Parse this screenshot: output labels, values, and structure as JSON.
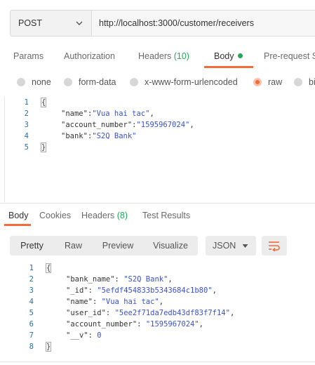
{
  "request": {
    "method": "POST",
    "url": "http://localhost:3000/customer/receivers"
  },
  "request_tabs": [
    {
      "label": "Params"
    },
    {
      "label": "Authorization"
    },
    {
      "label": "Headers",
      "count": "(10)"
    },
    {
      "label": "Body"
    },
    {
      "label": "Pre-request S"
    }
  ],
  "body_types": [
    {
      "label": "none",
      "selected": false
    },
    {
      "label": "form-data",
      "selected": false
    },
    {
      "label": "x-www-form-urlencoded",
      "selected": false
    },
    {
      "label": "raw",
      "selected": true
    },
    {
      "label": "bi",
      "selected": false
    }
  ],
  "request_body": {
    "line_numbers": [
      "1",
      "2",
      "3",
      "4",
      "5"
    ],
    "open": "{",
    "close": "}",
    "fields": [
      {
        "key": "\"name\"",
        "sep": ":",
        "value": "\"Vua hai tac\"",
        "trail": ","
      },
      {
        "key": "\"account_number\"",
        "sep": ":",
        "value": "\"1595967024\"",
        "trail": ","
      },
      {
        "key": "\"bank\"",
        "sep": ":",
        "value": "\"S2Q Bank\"",
        "trail": ""
      }
    ]
  },
  "response_tabs": [
    {
      "label": "Body"
    },
    {
      "label": "Cookies"
    },
    {
      "label": "Headers",
      "count": "(8)"
    },
    {
      "label": "Test Results"
    }
  ],
  "view_modes": [
    "Pretty",
    "Raw",
    "Preview",
    "Visualize"
  ],
  "format": "JSON",
  "response_body": {
    "line_numbers": [
      "1",
      "2",
      "3",
      "4",
      "5",
      "6",
      "7",
      "8"
    ],
    "open": "{",
    "close": "}",
    "fields": [
      {
        "key": "\"bank_name\"",
        "sep": ": ",
        "value": "\"S2Q Bank\"",
        "trail": ","
      },
      {
        "key": "\"_id\"",
        "sep": ": ",
        "value": "\"5efdf454833b5343684c1b80\"",
        "trail": ","
      },
      {
        "key": "\"name\"",
        "sep": ": ",
        "value": "\"Vua hai tac\"",
        "trail": ","
      },
      {
        "key": "\"user_id\"",
        "sep": ": ",
        "value": "\"5ee2f71da7edb43df83f7f14\"",
        "trail": ","
      },
      {
        "key": "\"account_number\"",
        "sep": ": ",
        "value": "\"1595967024\"",
        "trail": ","
      },
      {
        "key": "\"__v\"",
        "sep": ": ",
        "value": "0",
        "trail": ""
      }
    ]
  },
  "colors": {
    "accent": "#f26b3a",
    "success": "#26a65b",
    "string": "#3a4fd8",
    "line_number": "#2a6fa8"
  },
  "icons": [
    "chevron-down-icon",
    "status-dot-icon",
    "radio-icon",
    "wrap-lines-icon"
  ]
}
